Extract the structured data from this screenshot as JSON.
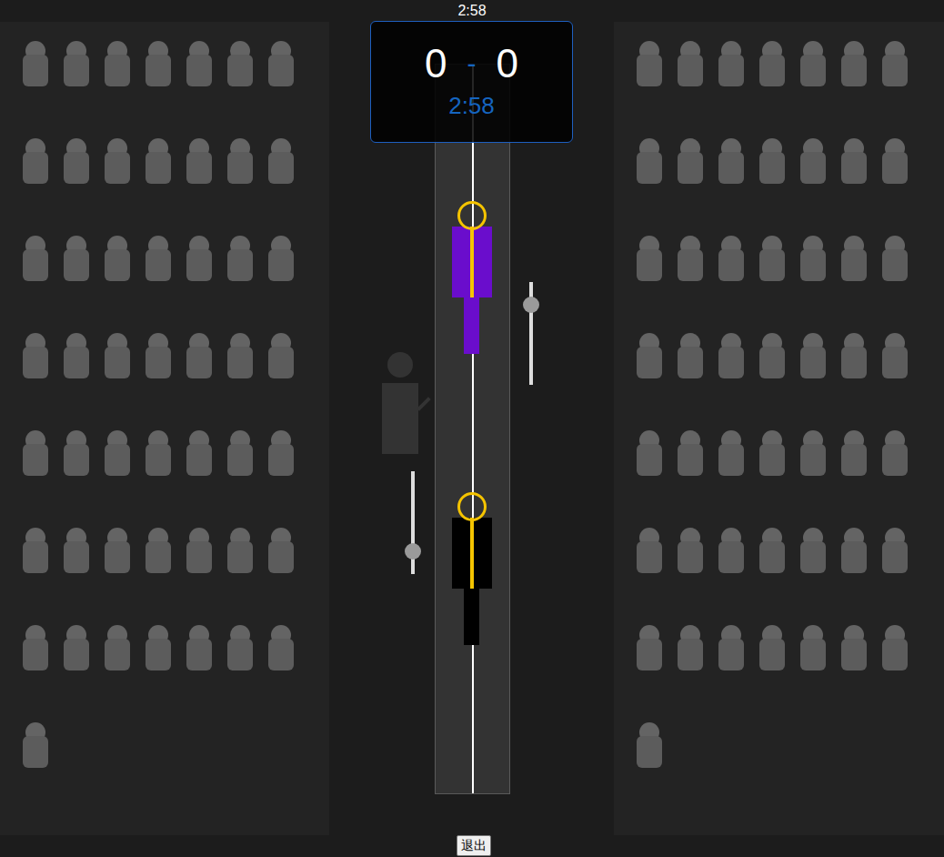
{
  "top_timer": "2:58",
  "scoreboard": {
    "left_score": "0",
    "separator": "-",
    "right_score": "0",
    "clock": "2:58"
  },
  "fencers": [
    {
      "color": "#6a0dcc"
    },
    {
      "color": "#000000"
    }
  ],
  "sliders": [
    {
      "level": 0.78
    },
    {
      "level": 0.22
    }
  ],
  "spectators": {
    "left_count": 50,
    "right_count": 50
  },
  "exit_button": {
    "label": "退出"
  }
}
